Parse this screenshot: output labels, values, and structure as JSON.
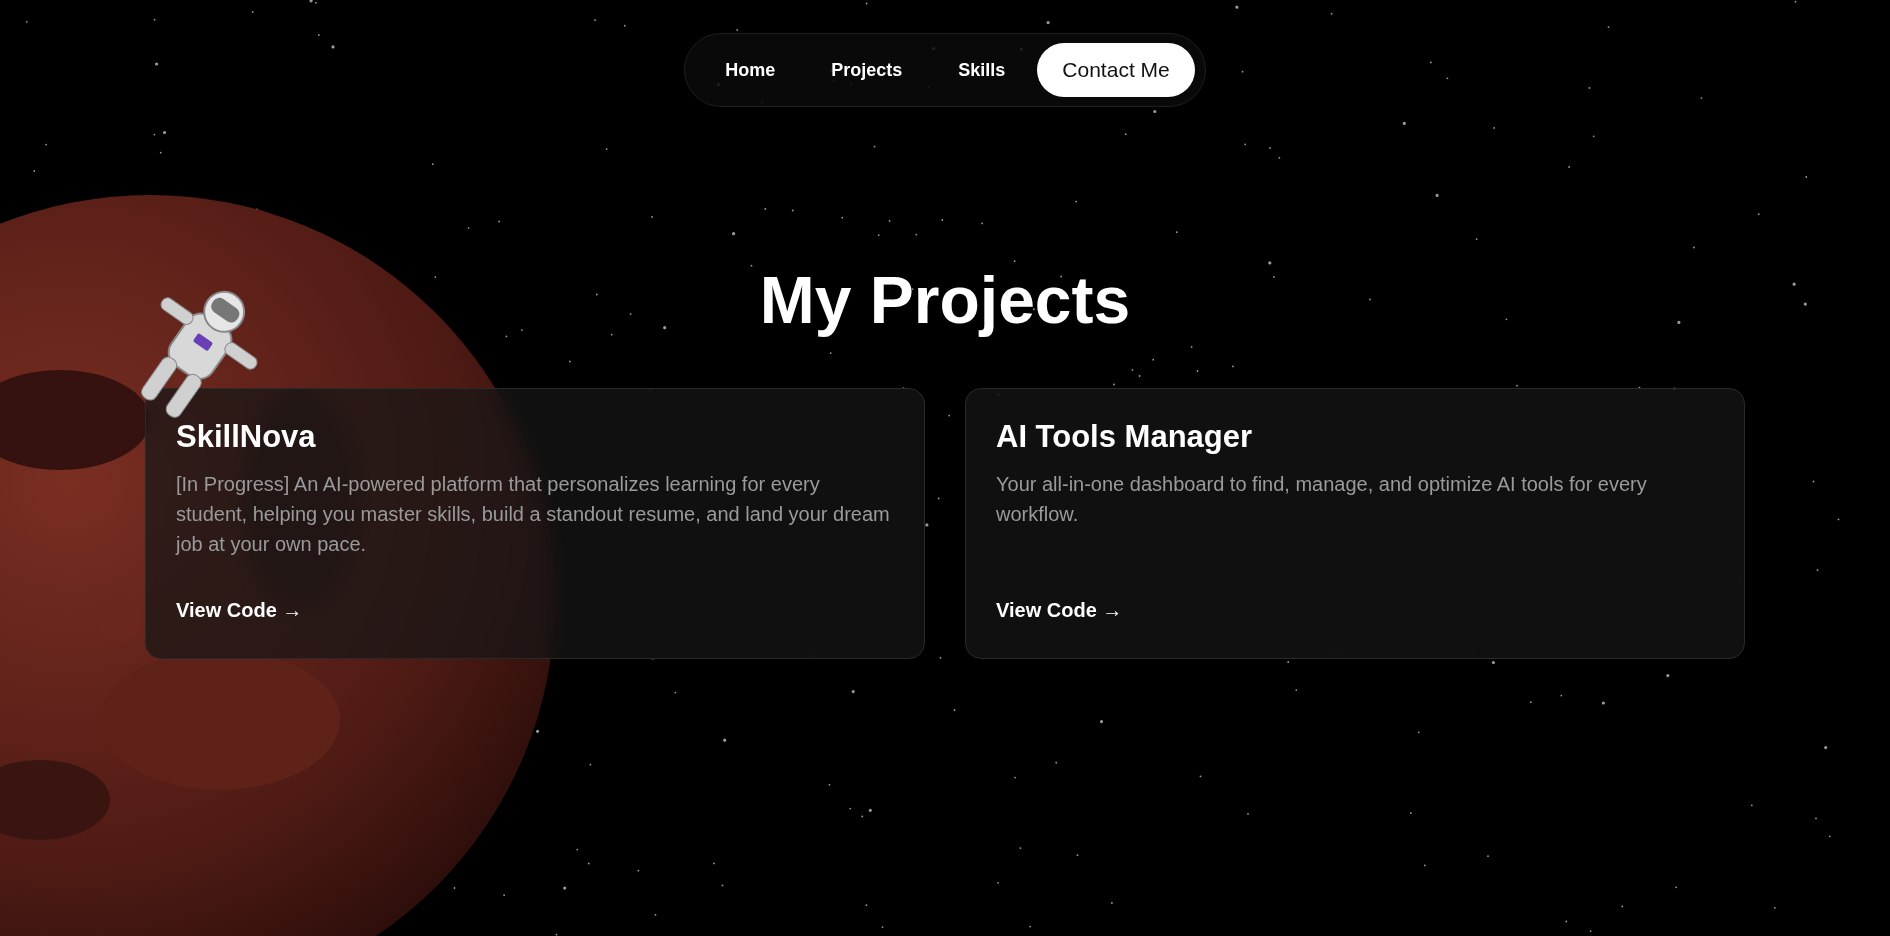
{
  "nav": {
    "items": [
      {
        "label": "Home",
        "kind": "link"
      },
      {
        "label": "Projects",
        "kind": "link"
      },
      {
        "label": "Skills",
        "kind": "link"
      },
      {
        "label": "Contact Me",
        "kind": "button"
      }
    ]
  },
  "title": "My Projects",
  "projects": [
    {
      "name": "SkillNova",
      "description": "[In Progress] An AI-powered platform that personalizes learning for every student, helping you master skills, build a standout resume, and land your dream job at your own pace.",
      "link": "View Code →"
    },
    {
      "name": "AI Tools Manager",
      "description": "Your all-in-one dashboard to find, manage, and optimize AI tools for every workflow.",
      "link": "View Code →"
    }
  ]
}
